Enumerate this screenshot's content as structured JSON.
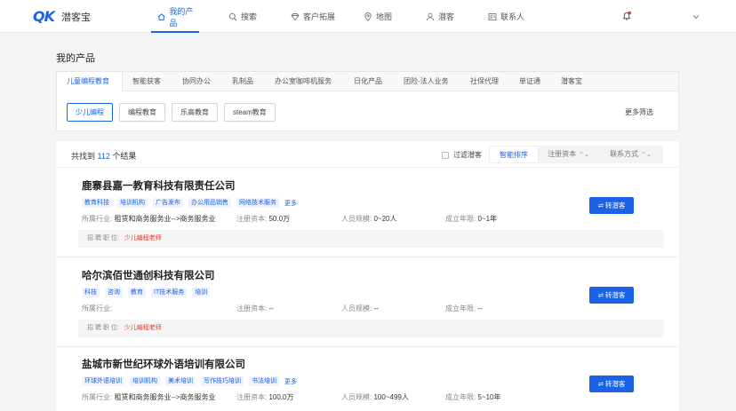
{
  "header": {
    "logo_mark": "QK",
    "brand": "潜客宝",
    "nav": [
      {
        "label": "我的产品",
        "icon": "home-icon",
        "active": true
      },
      {
        "label": "搜索",
        "icon": "search-icon",
        "active": false
      },
      {
        "label": "客户拓展",
        "icon": "diamond-icon",
        "active": false
      },
      {
        "label": "地图",
        "icon": "map-pin-icon",
        "active": false
      },
      {
        "label": "潜客",
        "icon": "user-icon",
        "active": false
      },
      {
        "label": "联系人",
        "icon": "contact-card-icon",
        "active": false
      }
    ]
  },
  "page": {
    "title": "我的产品"
  },
  "filter": {
    "categories": [
      "儿童编程教育",
      "智能获客",
      "协同办公",
      "乳制品",
      "办公室咖啡机服务",
      "日化产品",
      "团险-法人业务",
      "社保代理",
      "单证通",
      "潜客宝"
    ],
    "subtags": [
      "少儿编程",
      "编程教育",
      "乐高教育",
      "steam教育"
    ],
    "more_label": "更多筛选"
  },
  "results": {
    "found_prefix": "共找到",
    "count": "112",
    "found_suffix": "个结果",
    "filter_label": "过滤潜客",
    "sort": [
      {
        "label": "智能排序",
        "active": true,
        "arrow": ""
      },
      {
        "label": "注册资本",
        "active": false,
        "arrow": "⌃⌄"
      },
      {
        "label": "联系方式",
        "active": false,
        "arrow": "⌃⌄"
      }
    ]
  },
  "labels": {
    "industry": "所属行业:",
    "capital": "注册资本:",
    "staff": "人员规模:",
    "founded": "成立年限:",
    "job": "招  聘  职  位:",
    "button": "⇌ 转潜客",
    "more": "更多"
  },
  "companies": [
    {
      "name": "鹿寨县嘉一教育科技有限责任公司",
      "tags": [
        "教育科技",
        "培训机构",
        "广告发布",
        "办公用品销售",
        "网络技术服务"
      ],
      "has_more": true,
      "industry": "租赁和商务服务业-->商务服务业",
      "capital": "50.0万",
      "staff": "0~20人",
      "founded": "0~1年",
      "job": "少儿编程老师",
      "has_job": true
    },
    {
      "name": "哈尔滨佰世通创科技有限公司",
      "tags": [
        "科技",
        "咨询",
        "教育",
        "IT技术服务",
        "培训"
      ],
      "has_more": false,
      "industry": "",
      "capital": "--",
      "staff": "--",
      "founded": "--",
      "job": "少儿编程老师",
      "has_job": true
    },
    {
      "name": "盐城市新世纪环球外语培训有限公司",
      "tags": [
        "环球外语培训",
        "培训机构",
        "美术培训",
        "写作技巧培训",
        "书法培训"
      ],
      "has_more": true,
      "industry": "租赁和商务服务业-->商务服务业",
      "capital": "100.0万",
      "staff": "100~499人",
      "founded": "5~10年",
      "job": "",
      "has_job": false
    }
  ],
  "colors": {
    "accent": "#1b63e6",
    "job_red": "#e03a2f"
  }
}
